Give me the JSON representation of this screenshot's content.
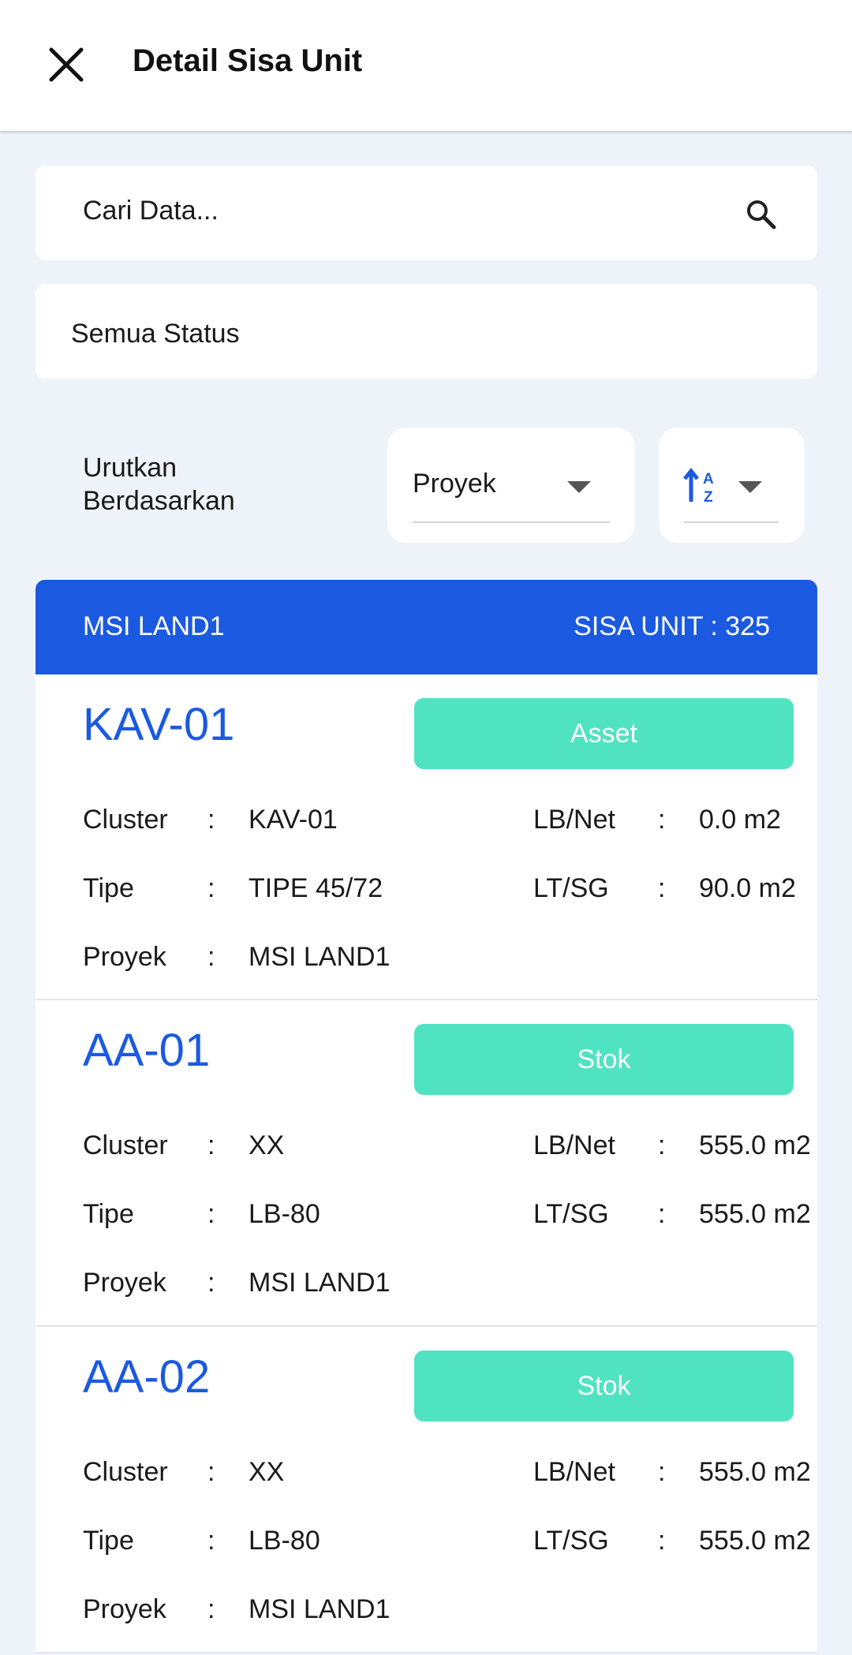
{
  "appbar": {
    "title": "Detail Sisa Unit"
  },
  "search": {
    "placeholder": "Cari Data..."
  },
  "status_filter": {
    "value": "Semua Status"
  },
  "sort": {
    "label_line1": "Urutkan",
    "label_line2": "Berdasarkan",
    "field": "Proyek",
    "order_icon": "sort-alpha-ascending-icon"
  },
  "project": {
    "name": "MSI LAND1",
    "remaining": "SISA UNIT : 325"
  },
  "labels": {
    "cluster": "Cluster",
    "tipe": "Tipe",
    "proyek": "Proyek",
    "lb_net": "LB/Net",
    "lt_sg": "LT/SG",
    "colon": ":"
  },
  "units": [
    {
      "code": "KAV-01",
      "status": "Asset",
      "cluster": "KAV-01",
      "tipe": "TIPE 45/72",
      "proyek": "MSI LAND1",
      "lb_net": "0.0 m2",
      "lt_sg": "90.0 m2"
    },
    {
      "code": "AA-01",
      "status": "Stok",
      "cluster": "XX",
      "tipe": "LB-80",
      "proyek": "MSI LAND1",
      "lb_net": "555.0 m2",
      "lt_sg": "555.0 m2"
    },
    {
      "code": "AA-02",
      "status": "Stok",
      "cluster": "XX",
      "tipe": "LB-80",
      "proyek": "MSI LAND1",
      "lb_net": "555.0 m2",
      "lt_sg": "555.0 m2"
    }
  ],
  "colors": {
    "primary": "#1b5ae0",
    "status": "#50e3c2",
    "background": "#eef3f9"
  }
}
